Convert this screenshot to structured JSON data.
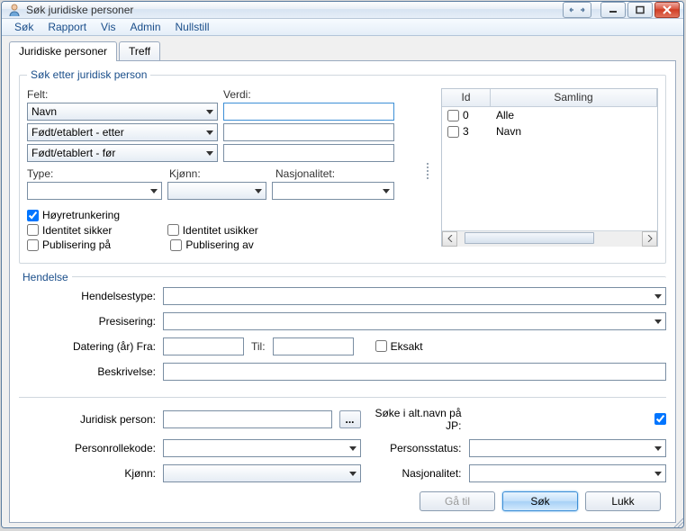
{
  "window": {
    "title": "Søk juridiske personer"
  },
  "menu": {
    "sok": "Søk",
    "rapport": "Rapport",
    "vis": "Vis",
    "admin": "Admin",
    "nullstill": "Nullstill"
  },
  "tabs": {
    "juridiske": "Juridiske personer",
    "treff": "Treff"
  },
  "group": {
    "legend": "Søk etter juridisk person"
  },
  "labels": {
    "felt": "Felt:",
    "verdi": "Verdi:",
    "type": "Type:",
    "kjonn": "Kjønn:",
    "nasjonalitet": "Nasjonalitet:",
    "hoyre": "Høyretrunkering",
    "idsikker": "Identitet sikker",
    "idusikker": "Identitet usikker",
    "pubpa": "Publisering på",
    "pubav": "Publisering av"
  },
  "felt": {
    "opt1": "Navn",
    "opt2": "Født/etablert - etter",
    "opt3": "Født/etablert - før"
  },
  "grid": {
    "col_id": "Id",
    "col_samling": "Samling",
    "rows": [
      {
        "id": "0",
        "samling": "Alle"
      },
      {
        "id": "3",
        "samling": "Navn"
      }
    ]
  },
  "hendelse": {
    "legend": "Hendelse",
    "hendelsestype": "Hendelsestype:",
    "presisering": "Presisering:",
    "datering_fra": "Datering (år) Fra:",
    "til": "Til:",
    "eksakt": "Eksakt",
    "beskrivelse": "Beskrivelse:"
  },
  "bottom": {
    "juridisk_person": "Juridisk person:",
    "soke_altnavn": "Søke i alt.navn på JP:",
    "personrollekode": "Personrollekode:",
    "personsstatus": "Personsstatus:",
    "kjonn": "Kjønn:",
    "nasjonalitet": "Nasjonalitet:"
  },
  "buttons": {
    "gatil": "Gå til",
    "sok": "Søk",
    "lukk": "Lukk",
    "browse": "..."
  }
}
